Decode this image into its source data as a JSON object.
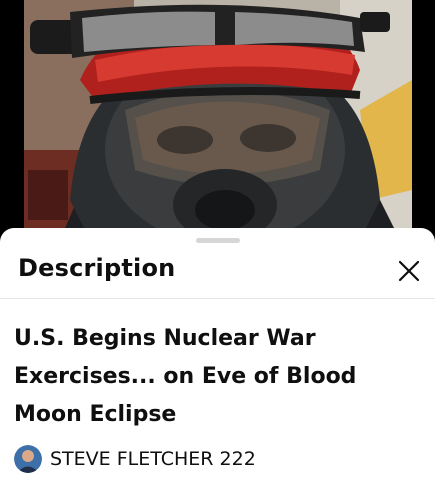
{
  "video": {
    "thumbnail": "gas-mask-person-image"
  },
  "description_panel": {
    "title": "Description",
    "close_icon": "close-icon"
  },
  "video_info": {
    "title": "U.S. Begins Nuclear War Exercises... on Eve of Blood Moon Eclipse",
    "channel_name": "STEVE FLETCHER 222",
    "avatar": "channel-avatar"
  },
  "colors": {
    "sheet_background": "#ffffff",
    "text": "#0f0f0f",
    "handle": "#d6d6d6"
  }
}
